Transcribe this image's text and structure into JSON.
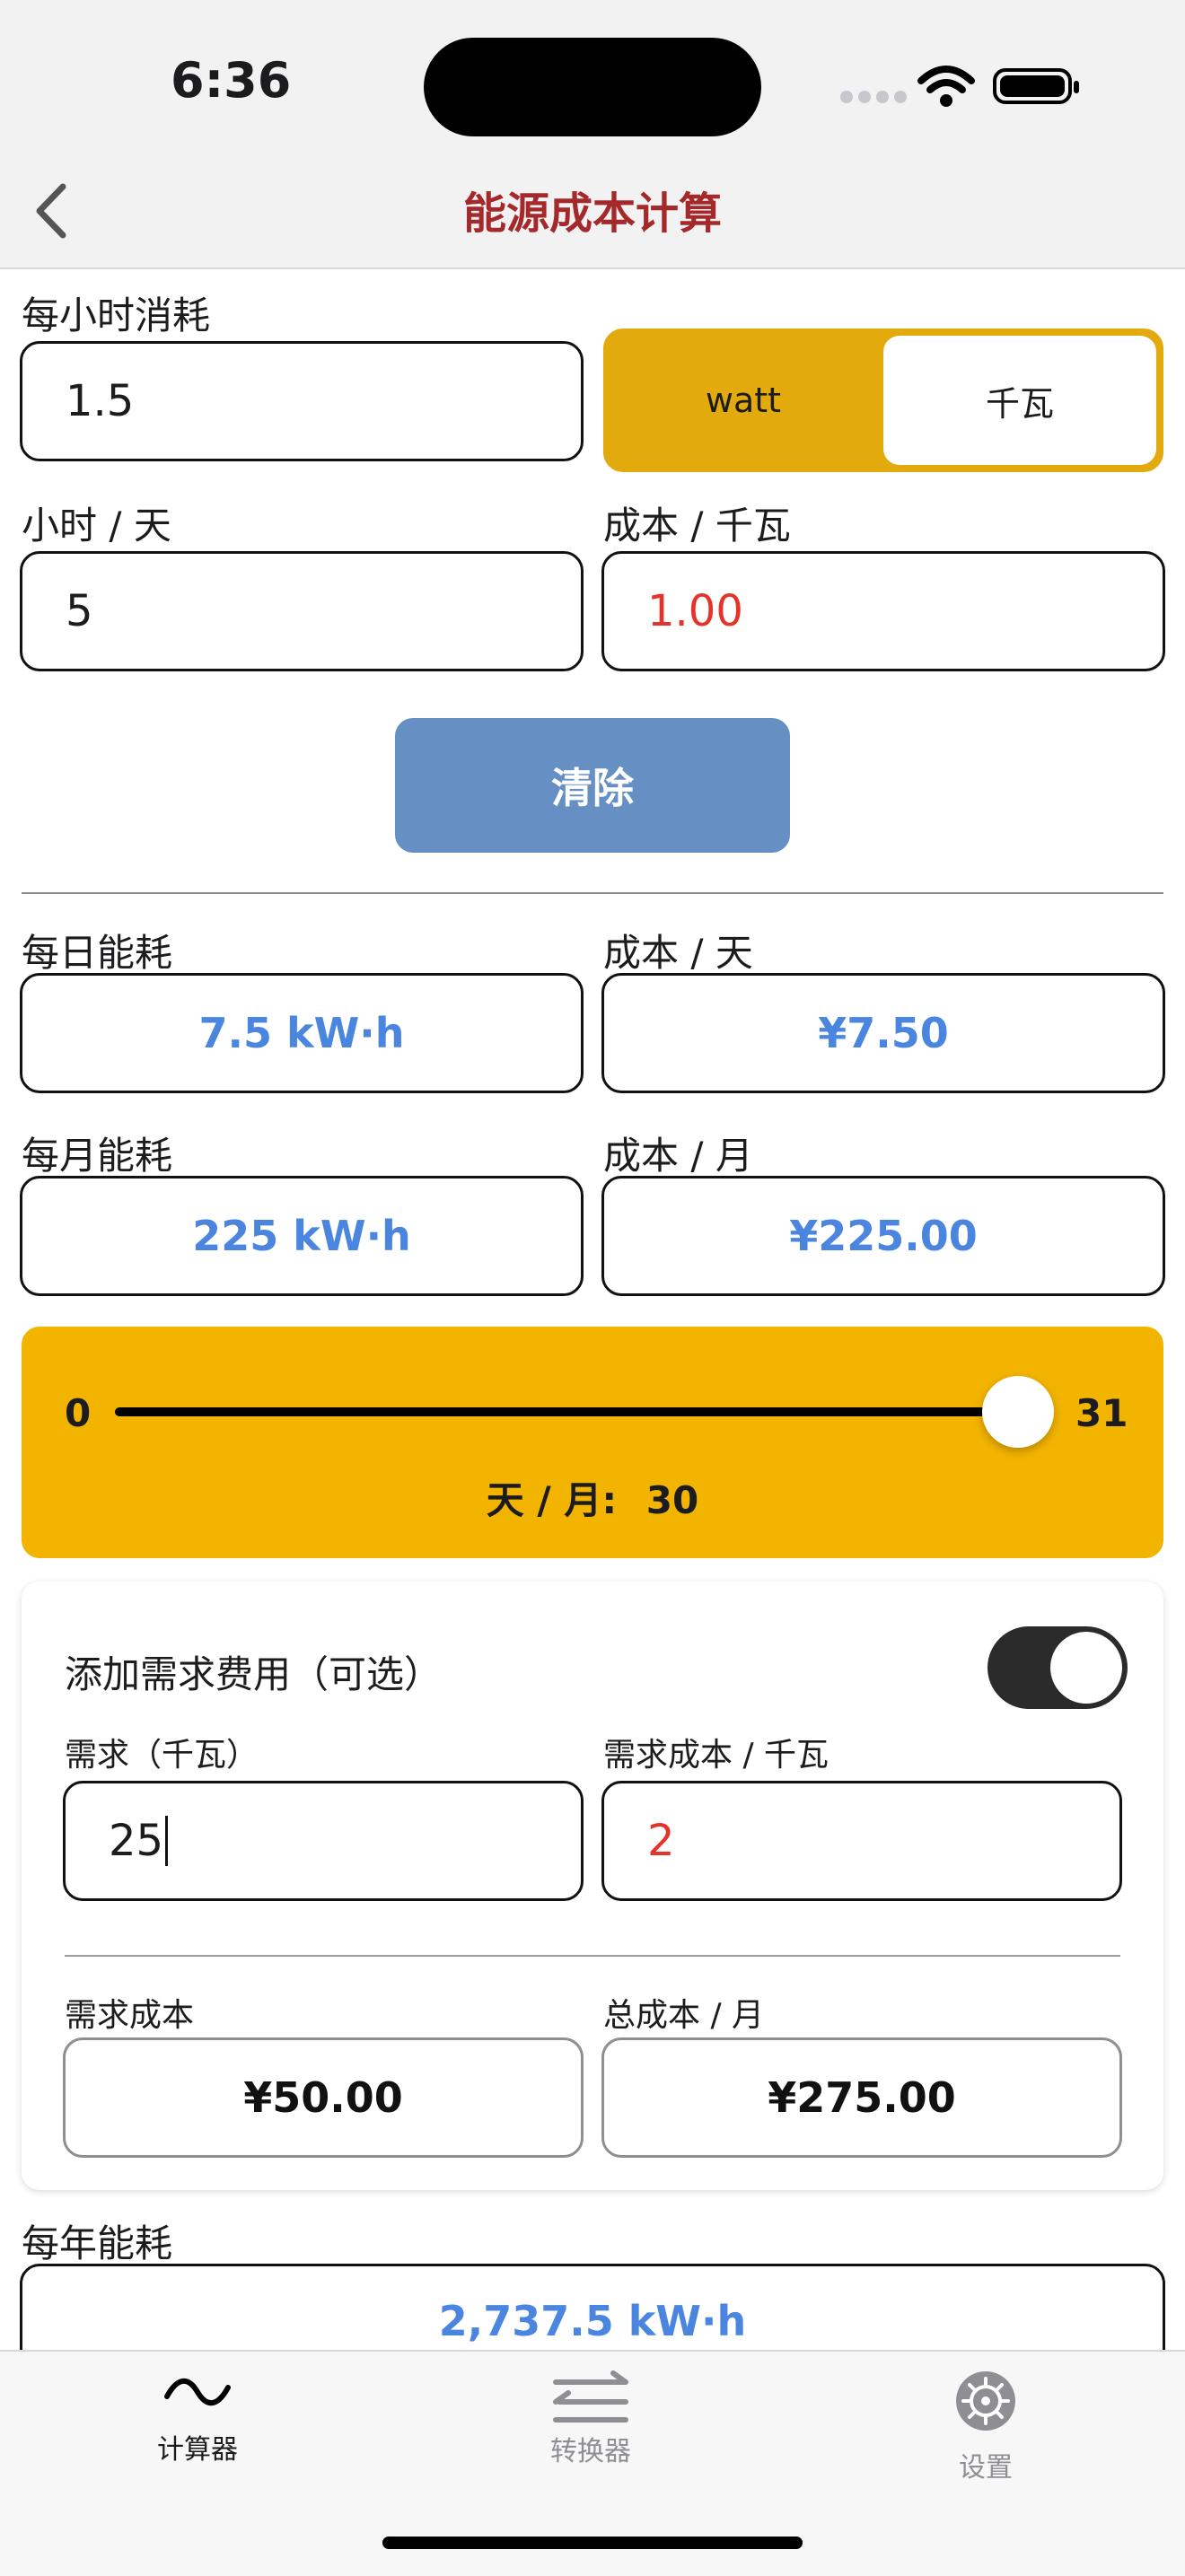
{
  "status_bar": {
    "time": "6:36"
  },
  "nav": {
    "title": "能源成本计算",
    "back_icon": "chevron-left-icon"
  },
  "inputs": {
    "hourly_label": "每小时消耗",
    "hourly_value": "1.5",
    "unit_options": [
      "watt",
      "千瓦"
    ],
    "unit_selected": "watt",
    "hours_label": "小时 / 天",
    "hours_value": "5",
    "cost_label": "成本 / 千瓦",
    "cost_value": "1.00",
    "clear_label": "清除"
  },
  "results": {
    "daily_energy_label": "每日能耗",
    "daily_energy_value": "7.5 kW·h",
    "daily_cost_label": "成本 / 天",
    "daily_cost_value": "¥7.50",
    "monthly_energy_label": "每月能耗",
    "monthly_energy_value": "225 kW·h",
    "monthly_cost_label": "成本 / 月",
    "monthly_cost_value": "¥225.00",
    "yearly_energy_label": "每年能耗",
    "yearly_energy_value": "2,737.5 kW·h"
  },
  "slider": {
    "min": "0",
    "max": "31",
    "value": 30,
    "readout_label": "天 / 月:",
    "readout_value": "30"
  },
  "demand": {
    "toggle_label": "添加需求费用（可选）",
    "toggle_on": true,
    "demand_label": "需求（千瓦）",
    "demand_value": "25",
    "demand_cost_rate_label": "需求成本 / 千瓦",
    "demand_cost_rate_value": "2",
    "demand_cost_label": "需求成本",
    "demand_cost_value": "¥50.00",
    "total_cost_label": "总成本 / 月",
    "total_cost_value": "¥275.00"
  },
  "tabs": [
    {
      "label": "计算器",
      "icon": "wave-icon",
      "active": true
    },
    {
      "label": "转换器",
      "icon": "swap-arrows-icon",
      "active": false
    },
    {
      "label": "设置",
      "icon": "gear-icon",
      "active": false
    }
  ],
  "colors": {
    "accent": "#f3b400",
    "title": "#a5282a",
    "result_blue": "#4a86e0",
    "input_red": "#e5332a"
  }
}
